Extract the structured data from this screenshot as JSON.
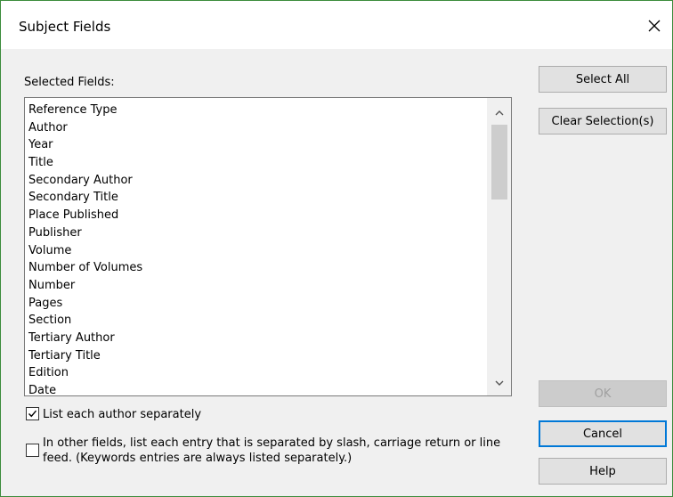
{
  "dialog": {
    "title": "Subject Fields",
    "close_icon": "close-icon"
  },
  "selected_fields": {
    "label": "Selected Fields:",
    "items": [
      "Reference Type",
      "Author",
      "Year",
      "Title",
      "Secondary Author",
      "Secondary Title",
      "Place Published",
      "Publisher",
      "Volume",
      "Number of Volumes",
      "Number",
      "Pages",
      "Section",
      "Tertiary Author",
      "Tertiary Title",
      "Edition",
      "Date"
    ]
  },
  "options": {
    "list_authors_label": "List each author separately",
    "list_authors_checked": true,
    "other_fields_label": "In other fields, list each entry that is separated by slash, carriage return or line feed. (Keywords entries are always listed separately.)",
    "other_fields_checked": false
  },
  "buttons": {
    "select_all": "Select All",
    "clear_selection": "Clear Selection(s)",
    "ok": "OK",
    "ok_enabled": false,
    "cancel": "Cancel",
    "help": "Help"
  }
}
